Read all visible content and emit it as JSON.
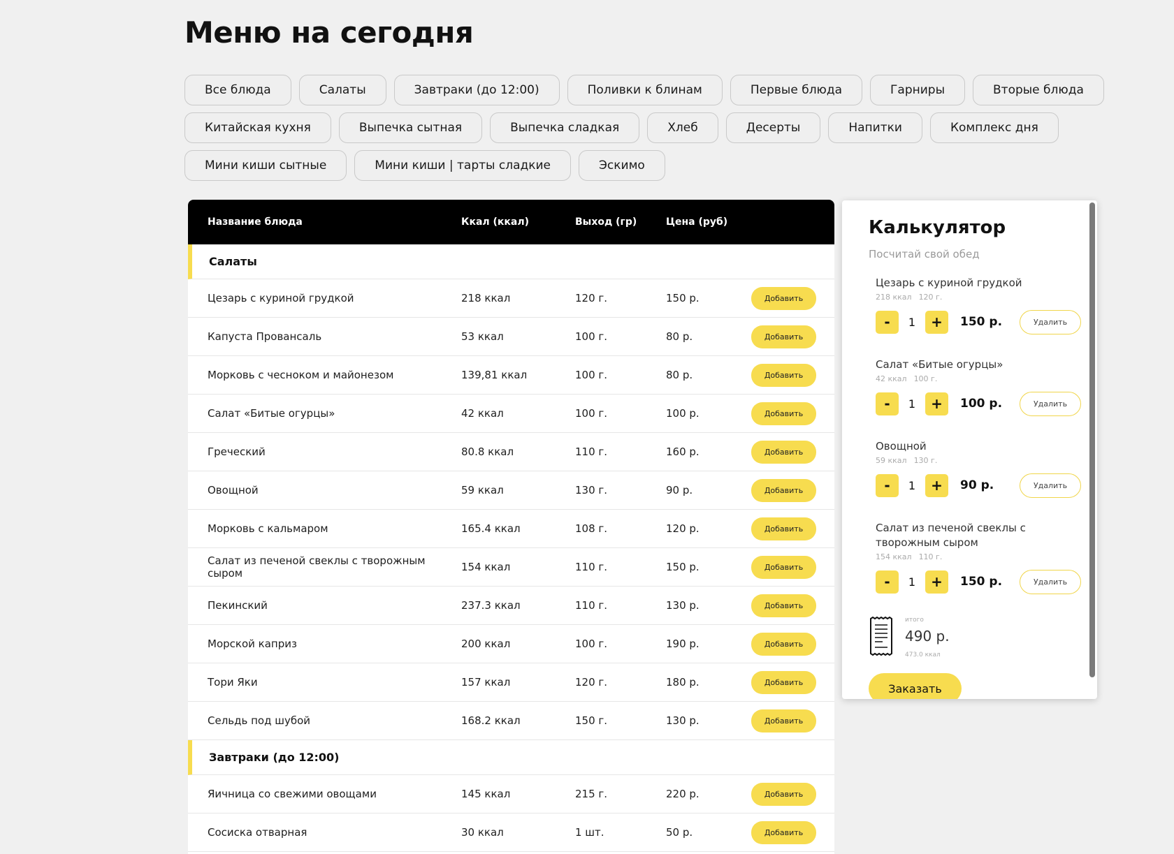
{
  "page_title": "Меню на сегодня",
  "filters": [
    [
      "Все блюда",
      "Салаты",
      "Завтраки (до 12:00)",
      "Поливки к блинам",
      "Первые блюда",
      "Гарниры",
      "Вторые блюда"
    ],
    [
      "Китайская кухня",
      "Выпечка сытная",
      "Выпечка сладкая",
      "Хлеб",
      "Десерты",
      "Напитки",
      "Комплекс дня"
    ],
    [
      "Мини киши сытные",
      "Мини киши | тарты сладкие",
      "Эскимо"
    ]
  ],
  "table": {
    "headers": {
      "name": "Название блюда",
      "kcal": "Ккал (ккал)",
      "weight": "Выход (гр)",
      "price": "Цена (руб)"
    },
    "add_label": "Добавить",
    "sections": [
      {
        "title": "Салаты",
        "items": [
          {
            "name": "Цезарь с куриной грудкой",
            "kcal": "218 ккал",
            "weight": "120 г.",
            "price": "150 р."
          },
          {
            "name": "Капуста Провансаль",
            "kcal": "53 ккал",
            "weight": "100 г.",
            "price": "80 р."
          },
          {
            "name": "Морковь с чесноком и майонезом",
            "kcal": "139,81 ккал",
            "weight": "100 г.",
            "price": "80 р."
          },
          {
            "name": "Салат «Битые огурцы»",
            "kcal": "42 ккал",
            "weight": "100 г.",
            "price": "100 р."
          },
          {
            "name": "Греческий",
            "kcal": "80.8 ккал",
            "weight": "110 г.",
            "price": "160 р."
          },
          {
            "name": "Овощной",
            "kcal": "59 ккал",
            "weight": "130 г.",
            "price": "90 р."
          },
          {
            "name": "Морковь с кальмаром",
            "kcal": "165.4 ккал",
            "weight": "108 г.",
            "price": "120 р."
          },
          {
            "name": "Салат из печеной свеклы с творожным сыром",
            "kcal": "154 ккал",
            "weight": "110 г.",
            "price": "150 р."
          },
          {
            "name": "Пекинский",
            "kcal": "237.3 ккал",
            "weight": "110 г.",
            "price": "130 р."
          },
          {
            "name": "Морской каприз",
            "kcal": "200 ккал",
            "weight": "100 г.",
            "price": "190 р."
          },
          {
            "name": "Тори Яки",
            "kcal": "157 ккал",
            "weight": "120 г.",
            "price": "180 р."
          },
          {
            "name": "Сельдь под шубой",
            "kcal": "168.2 ккал",
            "weight": "150 г.",
            "price": "130 р."
          }
        ]
      },
      {
        "title": "Завтраки (до 12:00)",
        "items": [
          {
            "name": "Яичница со свежими овощами",
            "kcal": "145 ккал",
            "weight": "215 г.",
            "price": "220 р."
          },
          {
            "name": "Сосиска отварная",
            "kcal": "30 ккал",
            "weight": "1 шт.",
            "price": "50 р."
          }
        ]
      }
    ]
  },
  "calculator": {
    "title": "Калькулятор",
    "subtitle": "Посчитай свой обед",
    "delete_label": "Удалить",
    "minus": "-",
    "plus": "+",
    "items": [
      {
        "name": "Цезарь с куриной грудкой",
        "kcal": "218 ккал",
        "weight": "120 г.",
        "qty": "1",
        "price": "150 р."
      },
      {
        "name": "Салат «Битые огурцы»",
        "kcal": "42 ккал",
        "weight": "100 г.",
        "qty": "1",
        "price": "100 р."
      },
      {
        "name": "Овощной",
        "kcal": "59 ккал",
        "weight": "130 г.",
        "qty": "1",
        "price": "90 р."
      },
      {
        "name": "Салат из печеной свеклы с творожным сыром",
        "kcal": "154 ккал",
        "weight": "110 г.",
        "qty": "1",
        "price": "150 р."
      }
    ],
    "total_label": "итого",
    "total_price": "490 р.",
    "total_kcal": "473.0 ккал",
    "order_label": "Заказать"
  },
  "colors": {
    "accent": "#f7dc4f",
    "header_bg": "#000000",
    "page_bg": "#f0f0f0"
  }
}
